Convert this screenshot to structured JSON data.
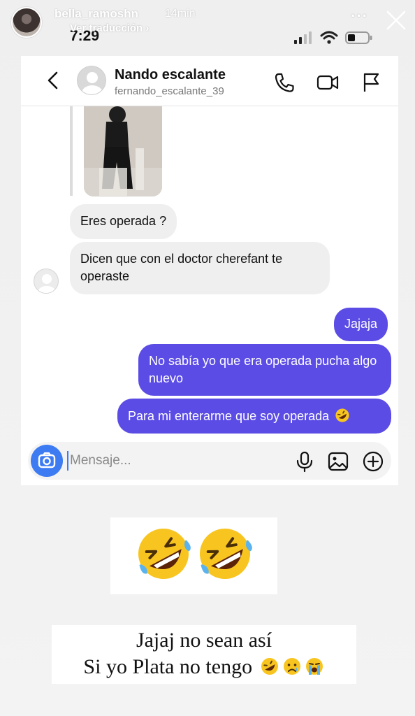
{
  "story": {
    "username": "bella_ramoshn",
    "time_ago": "14min",
    "translate_label": "Ver traducción",
    "translate_chevron": "›",
    "more_label": "···"
  },
  "status_bar": {
    "time": "7:29"
  },
  "chat": {
    "contact_name": "Nando escalante",
    "contact_handle": "fernando_escalante_39",
    "messages": [
      {
        "side": "in",
        "text": "Eres operada ?"
      },
      {
        "side": "in",
        "text": "Dicen que con el doctor cherefant te operaste"
      },
      {
        "side": "out",
        "text": "Jajaja"
      },
      {
        "side": "out",
        "text": "No sabía yo que era operada pucha algo nuevo"
      },
      {
        "side": "out",
        "text": "Para mi enterarme que soy operada"
      }
    ],
    "composer_placeholder": "Mensaje..."
  },
  "caption": {
    "line1": "Jajaj no sean así",
    "line2": "Si yo Plata no tengo"
  },
  "icons": [
    "back-icon",
    "phone-icon",
    "video-icon",
    "flag-icon",
    "camera-icon",
    "microphone-icon",
    "image-icon",
    "plus-icon",
    "close-icon",
    "rofl-emoji",
    "sad-emoji",
    "crying-emoji"
  ],
  "colors": {
    "outgoing_bubble": "#5b4ce5",
    "incoming_bubble": "#efefef",
    "camera_button": "#3d7bf2"
  }
}
